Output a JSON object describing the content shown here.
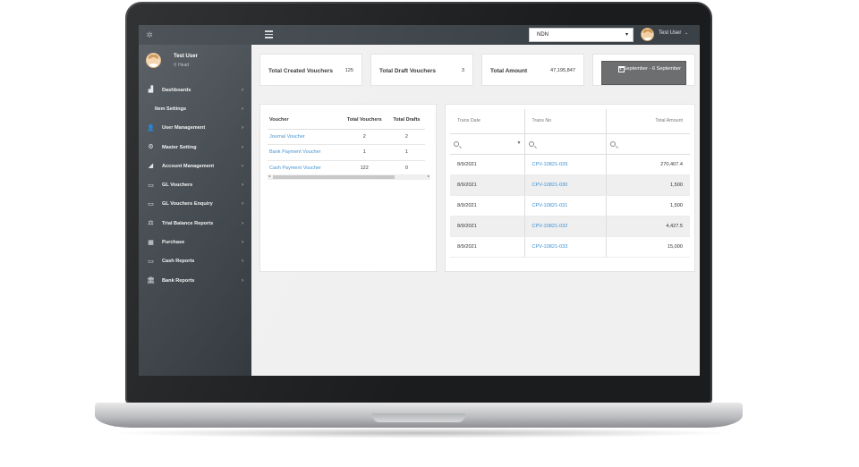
{
  "topbar": {
    "branch_value": "NDN",
    "user_name": "Test User"
  },
  "profile": {
    "name": "Test User",
    "location": "Head"
  },
  "sidebar": {
    "items": [
      {
        "label": "Dashboards",
        "icon": "chart-icon"
      },
      {
        "label": "Item Settings",
        "icon": ""
      },
      {
        "label": "User Management",
        "icon": "user-plus-icon"
      },
      {
        "label": "Master Setting",
        "icon": "cogs-icon"
      },
      {
        "label": "Account Management",
        "icon": "area-chart-icon"
      },
      {
        "label": "GL Vouchers",
        "icon": "money-icon"
      },
      {
        "label": "GL Vouchers Enquiry",
        "icon": "money-icon"
      },
      {
        "label": "Trial Balance Reports",
        "icon": "balance-scale-icon"
      },
      {
        "label": "Purchase",
        "icon": "grid-icon"
      },
      {
        "label": "Cash Reports",
        "icon": "money-icon"
      },
      {
        "label": "Bank Reports",
        "icon": "bank-icon"
      }
    ]
  },
  "stats": {
    "created_label": "Total Created Vouchers",
    "created_value": "125",
    "draft_label": "Total Draft Vouchers",
    "draft_value": "3",
    "amount_label": "Total Amount",
    "amount_value": "47,195,847",
    "date_range": "1 September - 6 September"
  },
  "voucher_table": {
    "headers": [
      "Voucher",
      "Total Vouchers",
      "Total Drafts"
    ],
    "rows": [
      [
        "Journal Voucher",
        "2",
        "2"
      ],
      [
        "Bank Payment Voucher",
        "1",
        "1"
      ],
      [
        "Cash Payment Voucher",
        "122",
        "0"
      ]
    ]
  },
  "trans_table": {
    "headers": [
      "Trans Date",
      "Trans No",
      "Total Amount"
    ],
    "rows": [
      [
        "8/9/2021",
        "CPV-10821-029",
        "270,407.4"
      ],
      [
        "8/9/2021",
        "CPV-10821-030",
        "1,500"
      ],
      [
        "8/9/2021",
        "CPV-10821-031",
        "1,500"
      ],
      [
        "8/9/2021",
        "CPV-10821-032",
        "4,427.5"
      ],
      [
        "8/9/2021",
        "CPV-10821-033",
        "15,000"
      ]
    ]
  },
  "colors": {
    "sidebar": "#3b4248",
    "topbar": "#3a4147",
    "link": "#3d8fd1",
    "date_button": "#6c6e70"
  }
}
